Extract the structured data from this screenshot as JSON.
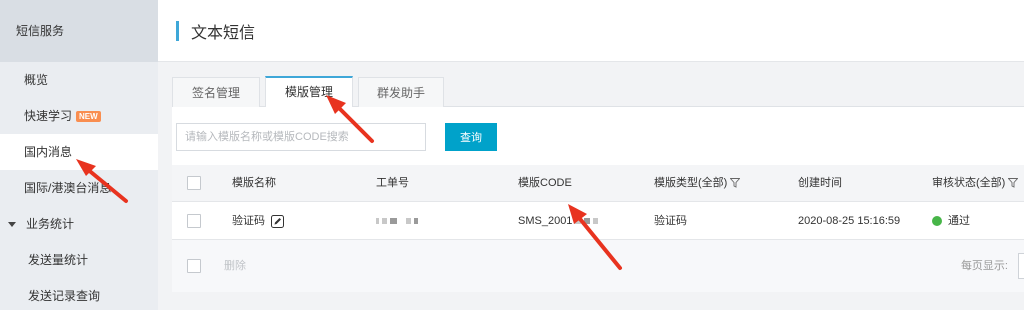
{
  "sidebar": {
    "header": "短信服务",
    "items": [
      {
        "label": "概览"
      },
      {
        "label": "快速学习",
        "badge": "NEW"
      },
      {
        "label": "国内消息",
        "active": true
      },
      {
        "label": "国际/港澳台消息"
      }
    ],
    "group": {
      "label": "业务统计",
      "children": [
        {
          "label": "发送量统计"
        },
        {
          "label": "发送记录查询"
        }
      ]
    }
  },
  "header": {
    "title": "文本短信"
  },
  "tabs": [
    {
      "label": "签名管理"
    },
    {
      "label": "模版管理",
      "active": true
    },
    {
      "label": "群发助手"
    }
  ],
  "search": {
    "placeholder": "请输入模版名称或模版CODE搜索",
    "button": "查询"
  },
  "table": {
    "columns": [
      "模版名称",
      "工单号",
      "模版CODE",
      "模版类型(全部)",
      "创建时间",
      "审核状态(全部)"
    ],
    "rows": [
      {
        "name": "验证码",
        "ticket": "",
        "code": "SMS_2001",
        "type": "验证码",
        "created": "2020-08-25 15:16:59",
        "status": "通过"
      }
    ],
    "footer": {
      "delete": "删除",
      "per_page": "每页显示:"
    }
  },
  "colors": {
    "accent": "#3ea7d8",
    "button": "#00a2ca",
    "status_ok": "#47b548",
    "arrow": "#e8331f",
    "badge": "#f98e50"
  }
}
